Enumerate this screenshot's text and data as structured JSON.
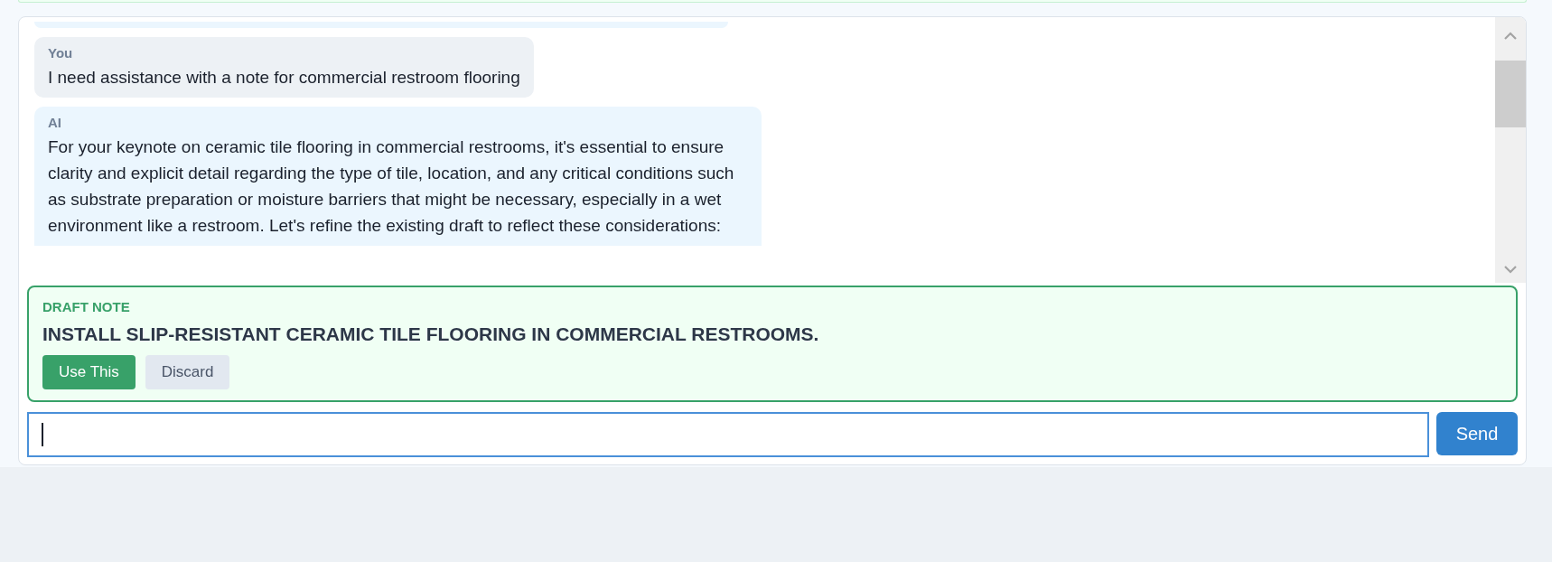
{
  "messages": [
    {
      "kind": "user",
      "sender": "You",
      "text": "I need assistance with a note for commercial restroom flooring"
    },
    {
      "kind": "assistant",
      "sender": "AI",
      "text": "For your keynote on ceramic tile flooring in commercial restrooms, it's essential to ensure clarity and explicit detail regarding the type of tile, location, and any critical conditions such as substrate preparation or moisture barriers that might be necessary, especially in a wet environment like a restroom. Let's refine the existing draft to reflect these considerations:"
    }
  ],
  "draft_note": {
    "label": "DRAFT NOTE",
    "text": "INSTALL SLIP-RESISTANT CERAMIC TILE FLOORING IN COMMERCIAL RESTROOMS.",
    "buttons": [
      {
        "kind": "primary",
        "label": "Use This"
      },
      {
        "kind": "secondary",
        "label": "Discard"
      }
    ]
  },
  "composer": {
    "send_label": "Send"
  }
}
